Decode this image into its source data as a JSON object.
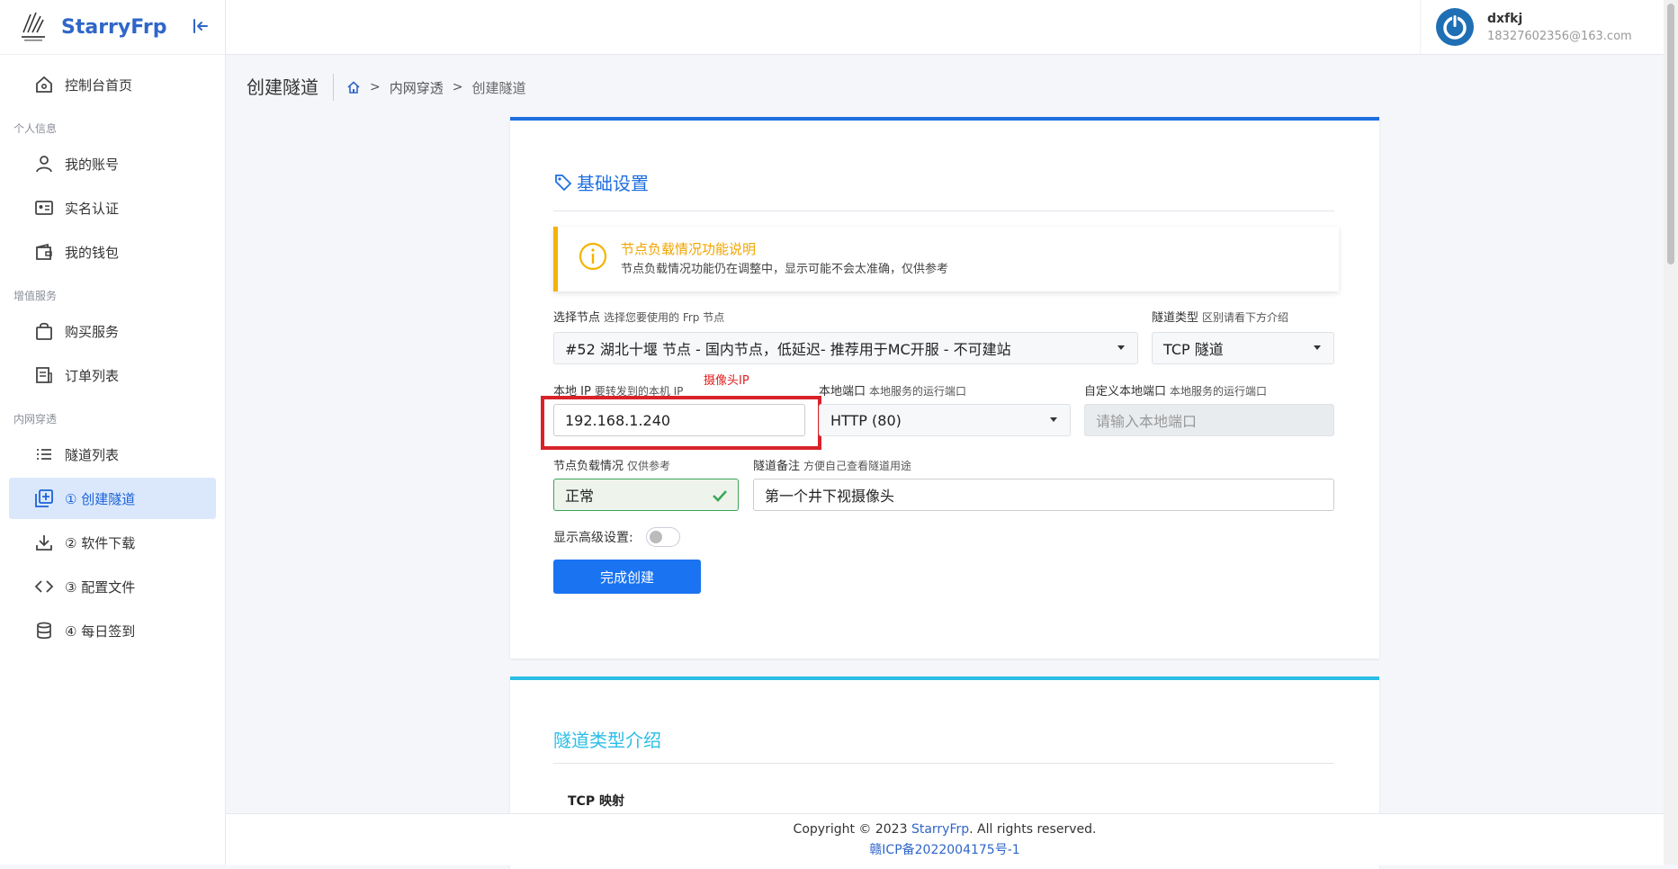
{
  "app": {
    "brand": "StarryFrp"
  },
  "user": {
    "name": "dxfkj",
    "email": "18327602356@163.com"
  },
  "sidebar": {
    "home": "控制台首页",
    "sections": {
      "personal": "个人信息",
      "value_added": "增值服务",
      "intranet": "内网穿透"
    },
    "items": {
      "account": "我的账号",
      "realname": "实名认证",
      "wallet": "我的钱包",
      "buy": "购买服务",
      "orders": "订单列表",
      "tunnels": "隧道列表",
      "create": "① 创建隧道",
      "download": "② 软件下载",
      "config": "③ 配置文件",
      "signin": "④ 每日签到"
    }
  },
  "header": {
    "page_title": "创建隧道",
    "breadcrumb": [
      "内网穿透",
      "创建隧道"
    ]
  },
  "basic": {
    "title": "基础设置",
    "alert_title": "节点负载情况功能说明",
    "alert_desc": "节点负载情况功能仍在调整中，显示可能不会太准确，仅供参考",
    "node_label": "选择节点",
    "node_hint": "选择您要使用的 Frp 节点",
    "node_value": "#52 湖北十堰 节点 - 国内节点，低延迟- 推荐用于MC开服 - 不可建站",
    "type_label": "隧道类型",
    "type_hint": "区别请看下方介绍",
    "type_value": "TCP 隧道",
    "ip_label": "本地 IP",
    "ip_hint": "要转发到的本机 IP",
    "ip_value": "192.168.1.240",
    "ip_annotation": "摄像头IP",
    "port_label": "本地端口",
    "port_hint": "本地服务的运行端口",
    "port_value": "HTTP (80)",
    "custom_port_label": "自定义本地端口",
    "custom_port_hint": "本地服务的运行端口",
    "custom_port_placeholder": "请输入本地端口",
    "load_label": "节点负载情况",
    "load_hint": "仅供参考",
    "load_value": "正常",
    "remark_label": "隧道备注",
    "remark_hint": "方便自己查看隧道用途",
    "remark_value": "第一个井下视摄像头",
    "advanced_label": "显示高级设置:",
    "advanced_enabled": false,
    "submit": "完成创建"
  },
  "intro": {
    "title": "隧道类型介绍",
    "tcp_heading": "TCP 映射"
  },
  "footer": {
    "copyright_prefix": "Copyright © 2023",
    "copyright_brand": "StarryFrp",
    "copyright_suffix": ". All rights reserved.",
    "icp": "赣ICP备2022004175号-1"
  },
  "colors": {
    "primary": "#1f6fe0",
    "accent_cyan": "#2bbde6",
    "warning": "#f4b400",
    "annotation_red": "#d8232a",
    "success": "#3aa655"
  }
}
